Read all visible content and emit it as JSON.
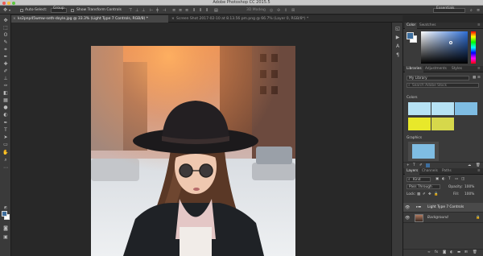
{
  "app": {
    "title": "Adobe Photoshop CC 2015.5"
  },
  "options_bar": {
    "auto_select_label": "Auto-Select:",
    "auto_select_value": "Group",
    "transform_label": "Show Transform Controls",
    "mode_3d_label": "3D Mode:",
    "workspace": "Essentials"
  },
  "doc_tabs": [
    {
      "label": "ks2pnp45wmw-seth-doyle.jpg @ 33.3% (Light Type 7 Controls, RGB/8) *",
      "active": true
    },
    {
      "label": "Screen Shot 2017-02-10 at 8.13.56 pm.png @ 66.7% (Layer 0, RGB/8*) *",
      "active": false
    }
  ],
  "color_panel": {
    "tabs": [
      "Color",
      "Swatches"
    ],
    "foreground": "#3d6e9e",
    "background": "#ffffff"
  },
  "libraries_panel": {
    "tabs": [
      "Libraries",
      "Adjustments",
      "Styles"
    ],
    "library_name": "My Library",
    "search_placeholder": "Search Adobe Stock",
    "colors_label": "Colors",
    "graphics_label": "Graphics",
    "color_tiles": [
      "#b6e2f4",
      "#b6e2f4",
      "#7fbde3",
      "#e8e82a",
      "#d6d84b"
    ],
    "graphic_color": "#7fbde3"
  },
  "layers_panel": {
    "tabs": [
      "Layers",
      "Channels",
      "Paths"
    ],
    "filter_value": "Kind",
    "blend_mode": "Pass Through",
    "opacity_label": "Opacity:",
    "opacity_value": "100%",
    "lock_label": "Lock:",
    "fill_label": "Fill:",
    "fill_value": "100%",
    "layers": [
      {
        "name": "Light Type 7 Controls",
        "type": "group",
        "selected": true
      },
      {
        "name": "Background",
        "type": "image",
        "selected": false
      }
    ]
  }
}
